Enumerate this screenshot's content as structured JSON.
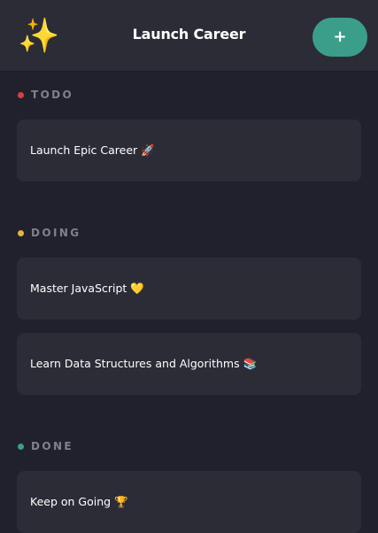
{
  "header": {
    "logo_glyph": "✨",
    "title": "Launch Career",
    "add_label": "+"
  },
  "columns": [
    {
      "name": "TODO",
      "color": "#d94040",
      "tasks": [
        {
          "title": "Launch Epic Career 🚀"
        }
      ]
    },
    {
      "name": "DOING",
      "color": "#e6b53a",
      "tasks": [
        {
          "title": "Master JavaScript 💛"
        },
        {
          "title": "Learn Data Structures and Algorithms 📚"
        }
      ]
    },
    {
      "name": "DONE",
      "color": "#3b9e8b",
      "tasks": [
        {
          "title": "Keep on Going 🏆"
        }
      ]
    }
  ],
  "colors": {
    "background": "#21212d",
    "surface": "#2c2c37",
    "accent": "#3b9e8b",
    "muted_text": "#81818e"
  }
}
